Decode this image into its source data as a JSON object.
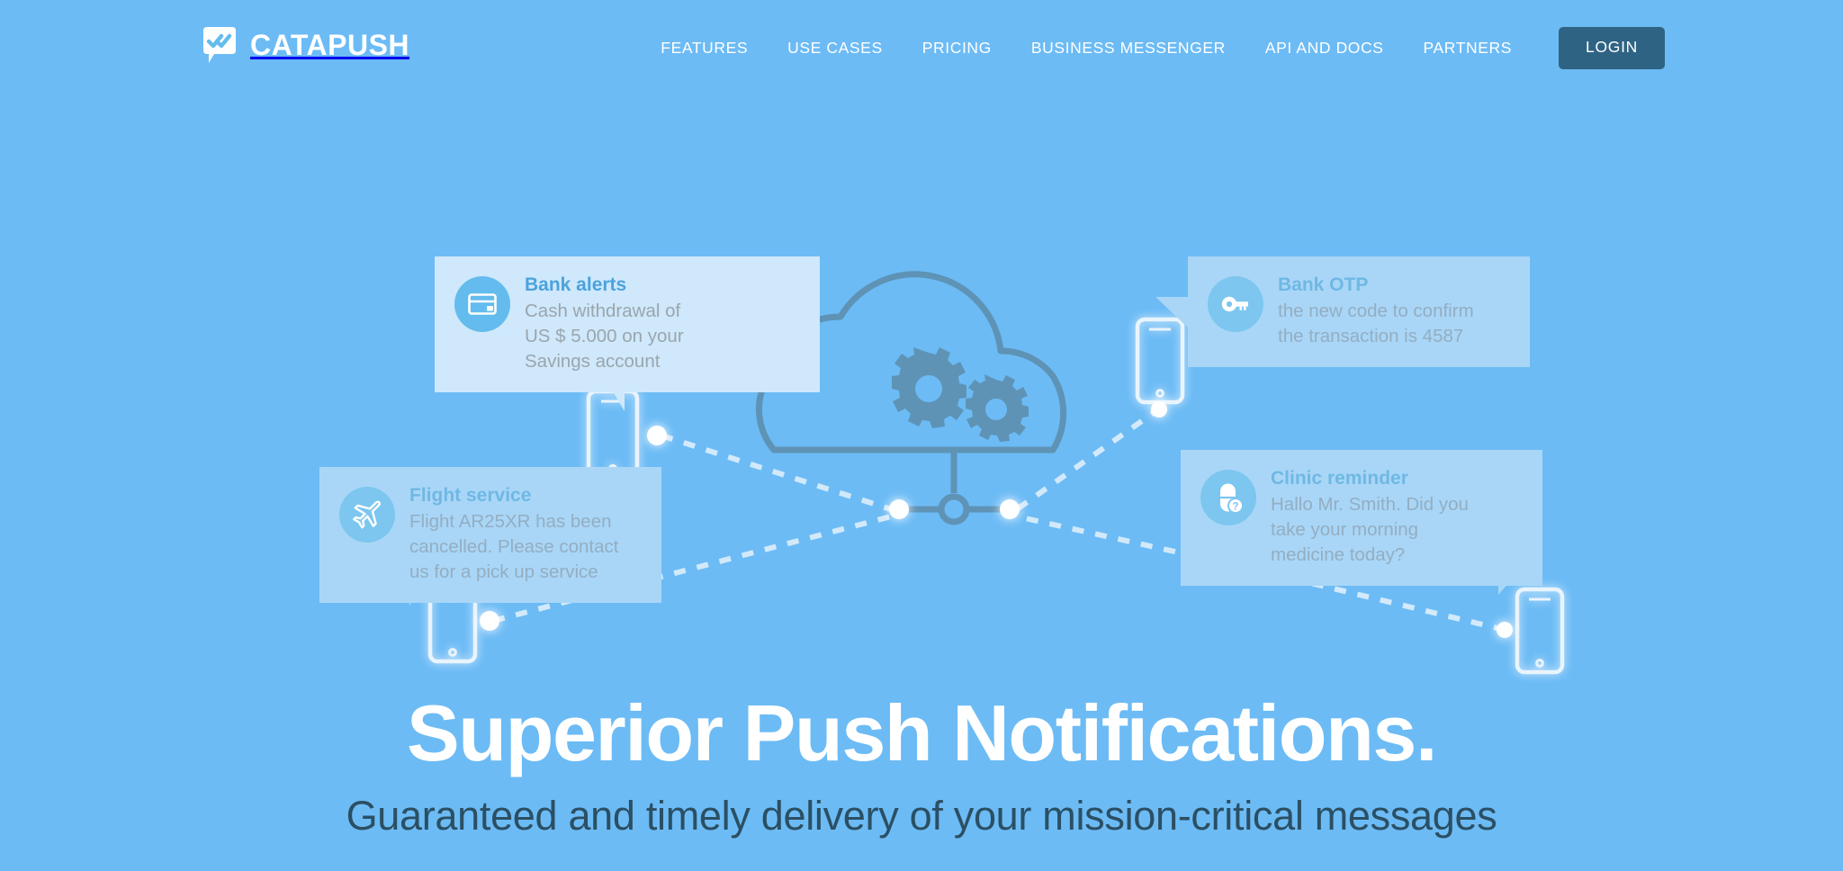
{
  "theme": {
    "background": "#6cbbf5",
    "card_solid": "#cfe8fb",
    "card_faded": "#a9d6f7",
    "icon_circle": "#63bced",
    "title_blue": "#4ba3dd",
    "body_gray": "#9aa6ad",
    "login_button": "#2f6384",
    "cloud_stroke": "#5e93b5",
    "subhead_color": "#2b4f63",
    "white": "#ffffff"
  },
  "header": {
    "brand": {
      "name": "CATAPUSH",
      "logo_icon": "speech-bubble-double-check-icon"
    },
    "nav": [
      {
        "label": "FEATURES"
      },
      {
        "label": "USE CASES"
      },
      {
        "label": "PRICING"
      },
      {
        "label": "BUSINESS MESSENGER"
      },
      {
        "label": "API AND DOCS"
      },
      {
        "label": "PARTNERS"
      }
    ],
    "login_label": "LOGIN"
  },
  "hero": {
    "headline": "Superior Push Notifications.",
    "subheadline": "Guaranteed and timely delivery of your mission-critical messages"
  },
  "illustration": {
    "cloud_icon": "cloud-gears-icon",
    "notifications": [
      {
        "id": "bank-alerts",
        "title": "Bank alerts",
        "text": "Cash withdrawal of\nUS $ 5.000 on your\nSavings account",
        "icon": "credit-card-icon",
        "style": "solid"
      },
      {
        "id": "bank-otp",
        "title": "Bank OTP",
        "text": "the new code to confirm\nthe transaction is 4587",
        "icon": "key-icon",
        "style": "faded"
      },
      {
        "id": "flight-service",
        "title": "Flight service",
        "text": "Flight AR25XR has been\ncancelled. Please contact\nus for a pick up service",
        "icon": "airplane-icon",
        "style": "faded"
      },
      {
        "id": "clinic-reminder",
        "title": "Clinic reminder",
        "text": "Hallo Mr. Smith. Did you\ntake your morning\nmedicine today?",
        "icon": "pill-question-icon",
        "style": "faded"
      }
    ],
    "devices": [
      {
        "id": "phone-bank-alerts"
      },
      {
        "id": "phone-bank-otp"
      },
      {
        "id": "phone-flight-service"
      },
      {
        "id": "phone-clinic-reminder"
      }
    ]
  }
}
